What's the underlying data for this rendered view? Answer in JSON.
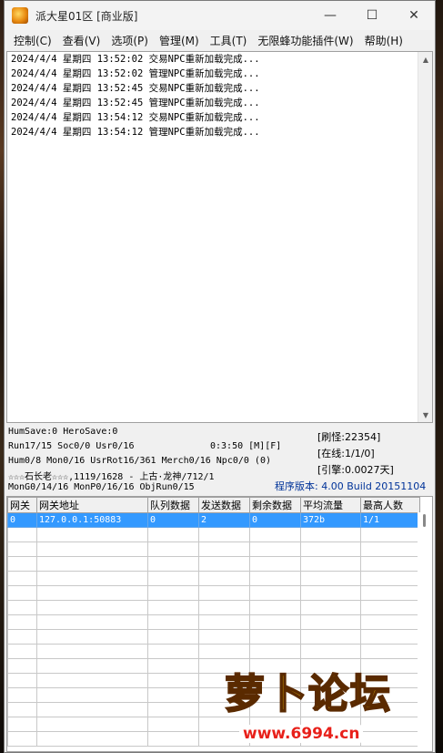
{
  "window": {
    "title": "派大星01区 [商业版]",
    "minimize": "—",
    "maximize": "☐",
    "close": "✕"
  },
  "menu": [
    "控制(C)",
    "查看(V)",
    "选项(P)",
    "管理(M)",
    "工具(T)",
    "无限蜂功能插件(W)",
    "帮助(H)"
  ],
  "log": [
    "2024/4/4 星期四 13:52:02 交易NPC重新加载完成...",
    "2024/4/4 星期四 13:52:02 管理NPC重新加载完成...",
    "2024/4/4 星期四 13:52:45 交易NPC重新加载完成...",
    "2024/4/4 星期四 13:52:45 管理NPC重新加载完成...",
    "2024/4/4 星期四 13:54:12 交易NPC重新加载完成...",
    "2024/4/4 星期四 13:54:12 管理NPC重新加载完成..."
  ],
  "status": {
    "line1": "HumSave:0 HeroSave:0",
    "line2": "Run17/15 Soc0/0 Usr0/16",
    "time": "0:3:50 [M][F]",
    "line3": "Hum0/8 Mon0/16 UsrRot16/361 Merch0/16 Npc0/0 (0)",
    "line4": "☆☆☆石长老☆☆☆,1119/1628 - 上古·龙神/712/1",
    "line5": "MonG0/14/16 MonP0/16/16 ObjRun0/15",
    "brush": "[刷怪:22354]",
    "online": "[在线:1/1/0]",
    "engine": "[引擎:0.0027天]",
    "version": "程序版本: 4.00 Build 20151104"
  },
  "grid": {
    "columns": [
      "网关",
      "网关地址",
      "队列数据",
      "发送数据",
      "剩余数据",
      "平均流量",
      "最高人数"
    ],
    "rows": [
      [
        "0",
        "127.0.0.1:50883",
        "0",
        "2",
        "0",
        "372b",
        "1/1"
      ]
    ]
  },
  "watermark": {
    "title": "萝卜论坛",
    "url": "www.6994.cn"
  }
}
